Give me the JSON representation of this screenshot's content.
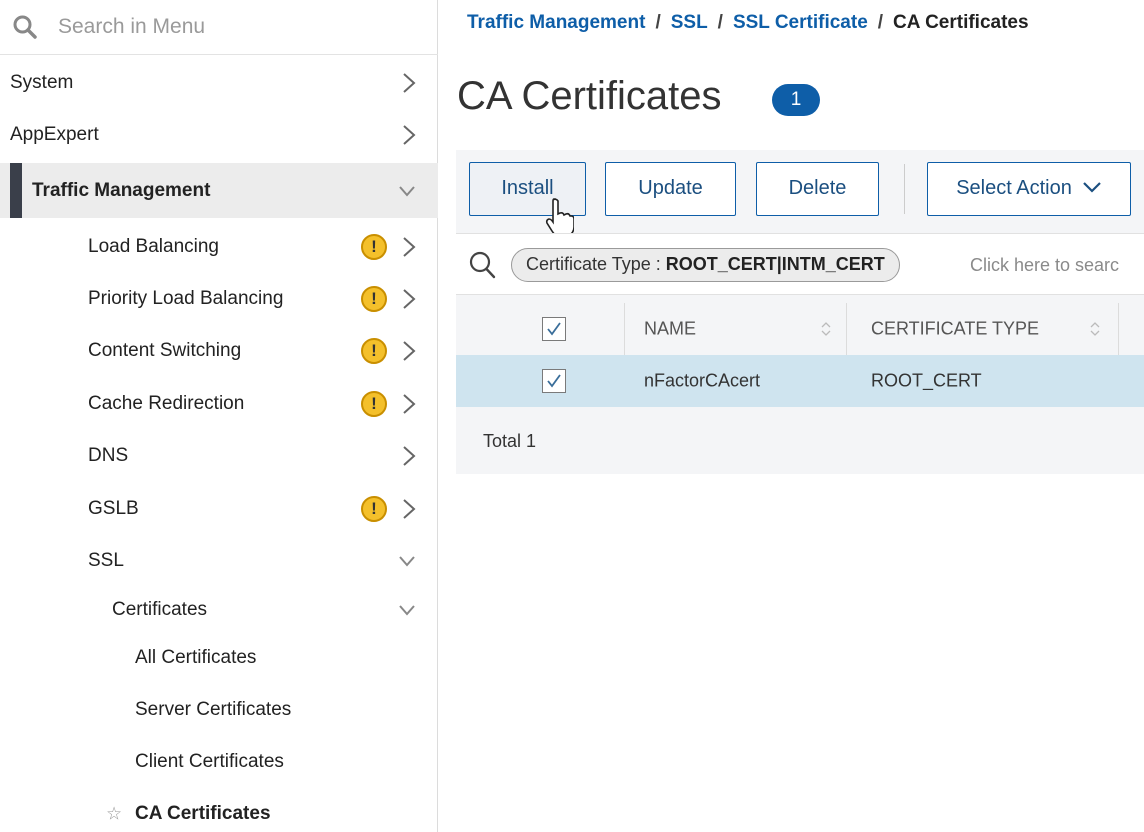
{
  "search": {
    "placeholder": "Search in Menu"
  },
  "sidebar": {
    "items": [
      {
        "label": "System"
      },
      {
        "label": "AppExpert"
      },
      {
        "label": "Traffic Management"
      },
      {
        "label": "Load Balancing"
      },
      {
        "label": "Priority Load Balancing"
      },
      {
        "label": "Content Switching"
      },
      {
        "label": "Cache Redirection"
      },
      {
        "label": "DNS"
      },
      {
        "label": "GSLB"
      },
      {
        "label": "SSL"
      },
      {
        "label": "Certificates"
      },
      {
        "label": "All Certificates"
      },
      {
        "label": "Server Certificates"
      },
      {
        "label": "Client Certificates"
      },
      {
        "label": "CA Certificates"
      }
    ],
    "warning_glyph": "!"
  },
  "breadcrumb": {
    "items": [
      "Traffic Management",
      "SSL",
      "SSL Certificate"
    ],
    "current": "CA Certificates",
    "separator": "/"
  },
  "page": {
    "title": "CA Certificates",
    "count": "1"
  },
  "toolbar": {
    "install_label": "Install",
    "update_label": "Update",
    "delete_label": "Delete",
    "select_action_label": "Select Action"
  },
  "filter": {
    "chip_key": "Certificate Type : ",
    "chip_value": "ROOT_CERT|INTM_CERT",
    "hint": "Click here to searc"
  },
  "table": {
    "headers": [
      "NAME",
      "CERTIFICATE TYPE"
    ],
    "rows": [
      {
        "name": "nFactorCAcert",
        "type": "ROOT_CERT",
        "checked": true
      }
    ],
    "total_label": "Total",
    "total_value": "1"
  },
  "colors": {
    "link": "#0e5ea8",
    "badge": "#0e5ea8",
    "warning": "#f4c02b",
    "selected_row": "#cfe4ef",
    "active_bar": "#3a3f4a"
  }
}
